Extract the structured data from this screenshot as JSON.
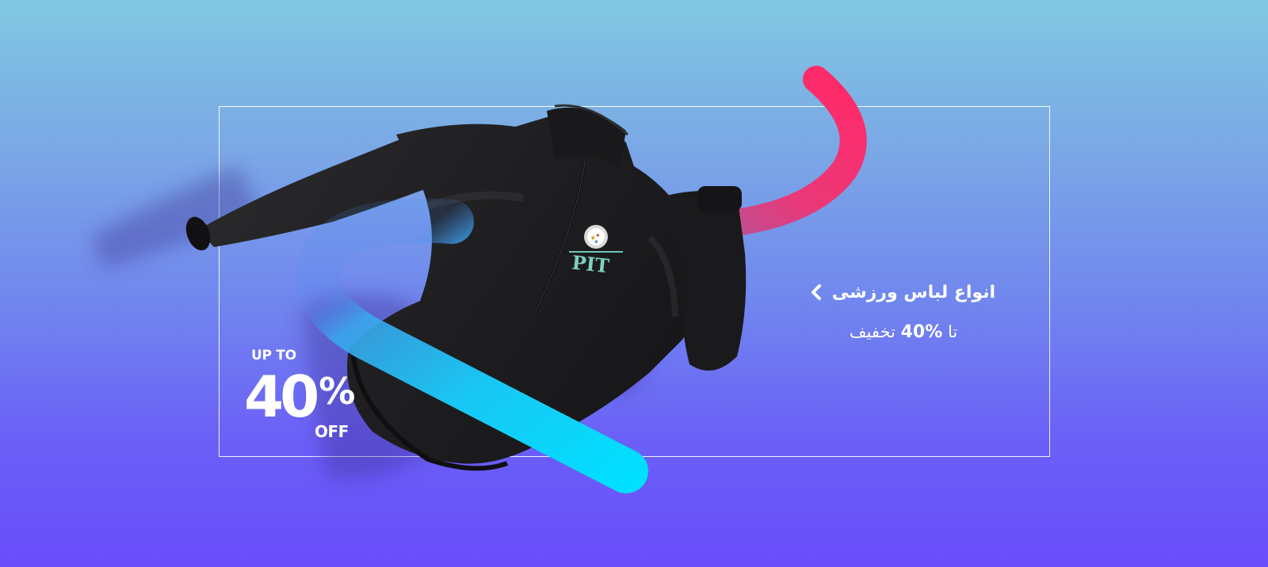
{
  "promo_en": {
    "up_to": "UP TO",
    "percent": "40",
    "percent_sign": "%",
    "off": "OFF"
  },
  "promo_fa": {
    "category_label": "انواع لباس ورزشی",
    "discount_prefix": "تا ",
    "discount_percent": "40%",
    "discount_suffix": " تخفیف"
  },
  "product": {
    "logo_text": "PIT"
  },
  "icons": {
    "category_arrow": "chevron-left-icon"
  },
  "colors": {
    "background_top": "#80c8e2",
    "background_bottom": "#6a4dfb",
    "ribbon_pink": "#ff2d6e",
    "ribbon_cyan": "#00dcff",
    "jacket": "#1b1b1d",
    "text": "#ffffff"
  }
}
